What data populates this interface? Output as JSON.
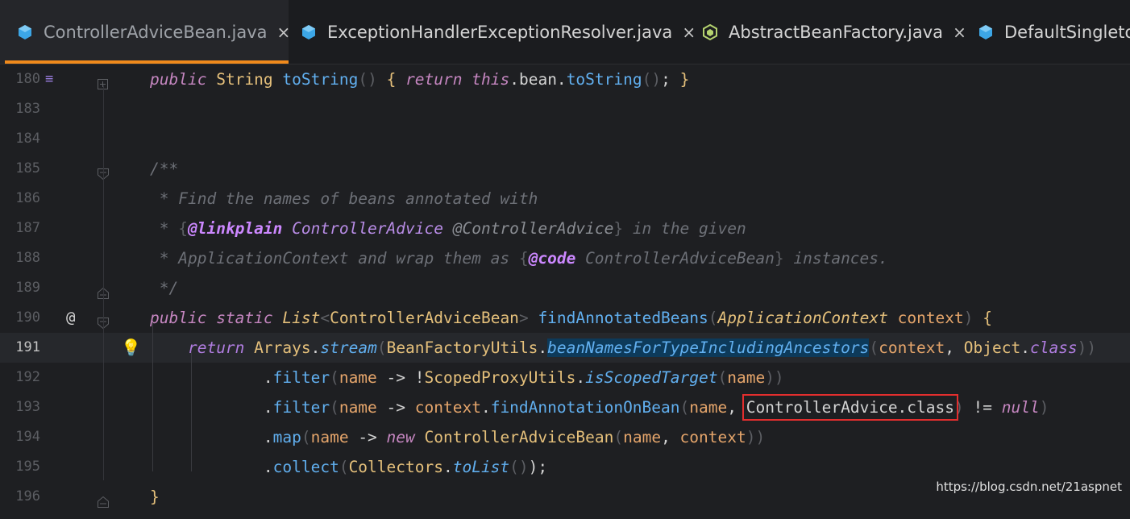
{
  "tabs": [
    {
      "name": "ControllerAdviceBean.java",
      "icon": "class-file-icon",
      "active": true,
      "close": "×"
    },
    {
      "name": "ExceptionHandlerExceptionResolver.java",
      "icon": "class-file-icon",
      "active": false,
      "close": "×"
    },
    {
      "name": "AbstractBeanFactory.java",
      "icon": "abstract-class-file-icon",
      "active": false,
      "close": "×"
    },
    {
      "name": "DefaultSingleto",
      "icon": "class-file-icon",
      "active": false,
      "close": ""
    }
  ],
  "lines": [
    {
      "num": "180",
      "tokens": [
        [
          "kw",
          "public"
        ],
        [
          "plain",
          " "
        ],
        [
          "typ",
          "String"
        ],
        [
          "plain",
          " "
        ],
        [
          "fn",
          "toString"
        ],
        [
          "punc",
          "()"
        ],
        [
          "plain",
          " "
        ],
        [
          "typ",
          "{"
        ],
        [
          "plain",
          " "
        ],
        [
          "kw",
          "return"
        ],
        [
          "plain",
          " "
        ],
        [
          "kw",
          "this"
        ],
        [
          "plain",
          ".bean."
        ],
        [
          "fn",
          "toString"
        ],
        [
          "punc",
          "()"
        ],
        [
          "plain",
          "; "
        ],
        [
          "typ",
          "}"
        ]
      ]
    },
    {
      "num": "183",
      "tokens": []
    },
    {
      "num": "184",
      "tokens": []
    },
    {
      "num": "185",
      "tokens": [
        [
          "cmt",
          "/**"
        ]
      ]
    },
    {
      "num": "186",
      "tokens": [
        [
          "cmt",
          " * Find the names of beans annotated with"
        ]
      ]
    },
    {
      "num": "187",
      "tokens": [
        [
          "cmt",
          " * "
        ],
        [
          "punc",
          "{"
        ],
        [
          "cmttag",
          "@linkplain"
        ],
        [
          "cmt",
          " "
        ],
        [
          "cmtref",
          "ControllerAdvice"
        ],
        [
          "cmt",
          " "
        ],
        [
          "anno",
          "@ControllerAdvice"
        ],
        [
          "punc",
          "}"
        ],
        [
          "cmt",
          " in the given"
        ]
      ]
    },
    {
      "num": "188",
      "tokens": [
        [
          "cmt",
          " * ApplicationContext and wrap them as "
        ],
        [
          "punc",
          "{"
        ],
        [
          "cmttag",
          "@code"
        ],
        [
          "cmt",
          " ControllerAdviceBean"
        ],
        [
          "punc",
          "}"
        ],
        [
          "cmt",
          " instances."
        ]
      ]
    },
    {
      "num": "189",
      "tokens": [
        [
          "cmt",
          " */"
        ]
      ]
    },
    {
      "num": "190",
      "tokens": [
        [
          "kw",
          "public"
        ],
        [
          "plain",
          " "
        ],
        [
          "kw",
          "static"
        ],
        [
          "plain",
          " "
        ],
        [
          "italtyp",
          "List"
        ],
        [
          "punc",
          "<"
        ],
        [
          "typ",
          "ControllerAdviceBean"
        ],
        [
          "punc",
          ">"
        ],
        [
          "plain",
          " "
        ],
        [
          "fn",
          "findAnnotatedBeans"
        ],
        [
          "punc",
          "("
        ],
        [
          "italtyp",
          "ApplicationContext"
        ],
        [
          "plain",
          " "
        ],
        [
          "param",
          "context"
        ],
        [
          "punc",
          ")"
        ],
        [
          "plain",
          " "
        ],
        [
          "typ",
          "{"
        ]
      ]
    },
    {
      "num": "191",
      "tokens": [
        [
          "plain",
          "    "
        ],
        [
          "kwb",
          "return"
        ],
        [
          "plain",
          " "
        ],
        [
          "typ",
          "Arrays"
        ],
        [
          "plain",
          "."
        ],
        [
          "static",
          "stream"
        ],
        [
          "punc",
          "("
        ],
        [
          "typ",
          "BeanFactoryUtils"
        ],
        [
          "plain",
          "."
        ],
        [
          "hl",
          "beanNamesForTypeIncludingAncestors"
        ],
        [
          "punc",
          "("
        ],
        [
          "param",
          "context"
        ],
        [
          "plain",
          ", "
        ],
        [
          "typ",
          "Object"
        ],
        [
          "plain",
          "."
        ],
        [
          "kwb",
          "class"
        ],
        [
          "punc",
          "))"
        ]
      ]
    },
    {
      "num": "192",
      "tokens": [
        [
          "plain",
          "            ."
        ],
        [
          "fn",
          "filter"
        ],
        [
          "punc",
          "("
        ],
        [
          "param",
          "name"
        ],
        [
          "plain",
          " -> !"
        ],
        [
          "typ",
          "ScopedProxyUtils"
        ],
        [
          "plain",
          "."
        ],
        [
          "static",
          "isScopedTarget"
        ],
        [
          "punc",
          "("
        ],
        [
          "param",
          "name"
        ],
        [
          "punc",
          "))"
        ]
      ]
    },
    {
      "num": "193",
      "tokens": [
        [
          "plain",
          "            ."
        ],
        [
          "fn",
          "filter"
        ],
        [
          "punc",
          "("
        ],
        [
          "param",
          "name"
        ],
        [
          "plain",
          " -> "
        ],
        [
          "param",
          "context"
        ],
        [
          "plain",
          "."
        ],
        [
          "fn",
          "findAnnotationOnBean"
        ],
        [
          "punc",
          "("
        ],
        [
          "param",
          "name"
        ],
        [
          "plain",
          ", "
        ],
        [
          "redbox",
          "ControllerAdvice.class"
        ],
        [
          "punc",
          ")"
        ],
        [
          "plain",
          " != "
        ],
        [
          "kw",
          "null"
        ],
        [
          "punc",
          ")"
        ]
      ]
    },
    {
      "num": "194",
      "tokens": [
        [
          "plain",
          "            ."
        ],
        [
          "fn",
          "map"
        ],
        [
          "punc",
          "("
        ],
        [
          "param",
          "name"
        ],
        [
          "plain",
          " -> "
        ],
        [
          "kw",
          "new"
        ],
        [
          "plain",
          " "
        ],
        [
          "typ",
          "ControllerAdviceBean"
        ],
        [
          "punc",
          "("
        ],
        [
          "param",
          "name"
        ],
        [
          "plain",
          ", "
        ],
        [
          "param",
          "context"
        ],
        [
          "punc",
          "))"
        ]
      ]
    },
    {
      "num": "195",
      "tokens": [
        [
          "plain",
          "            ."
        ],
        [
          "fn",
          "collect"
        ],
        [
          "punc",
          "("
        ],
        [
          "typ",
          "Collectors"
        ],
        [
          "plain",
          "."
        ],
        [
          "static",
          "toList"
        ],
        [
          "punc",
          "()"
        ],
        [
          "plain",
          ");"
        ]
      ]
    },
    {
      "num": "196",
      "tokens": [
        [
          "typ",
          "}"
        ]
      ]
    }
  ],
  "gutter": {
    "override_mark": "≡",
    "at_mark": "@",
    "bulb": "💡"
  },
  "watermark": "https://blog.csdn.net/21aspnet",
  "colors": {
    "accent": "#f08a1c",
    "highlight": "#0d3a5a",
    "redbox": "#e22e2e"
  }
}
